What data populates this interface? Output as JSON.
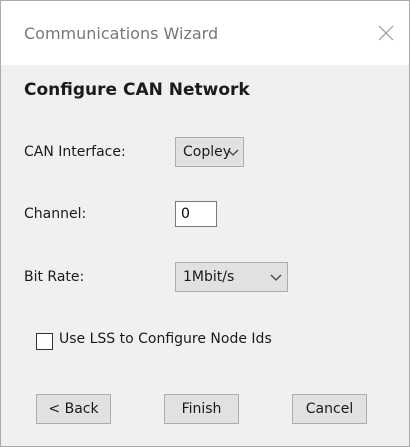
{
  "window": {
    "title": "Communications Wizard"
  },
  "icons": {
    "close": "close-icon",
    "dropdown": "chevron-down-icon"
  },
  "heading": "Configure CAN Network",
  "can_interface": {
    "label": "CAN Interface:",
    "value": "Copley"
  },
  "channel": {
    "label": "Channel:",
    "value": "0"
  },
  "bit_rate": {
    "label": "Bit Rate:",
    "value": "1Mbit/s"
  },
  "lss": {
    "label": "Use LSS to Configure Node Ids",
    "checked": false
  },
  "buttons": {
    "back": "< Back",
    "finish": "Finish",
    "cancel": "Cancel"
  },
  "colors": {
    "content_bg": "#f0f0f0",
    "button_bg": "#e1e1e1",
    "title_text": "#777777"
  }
}
